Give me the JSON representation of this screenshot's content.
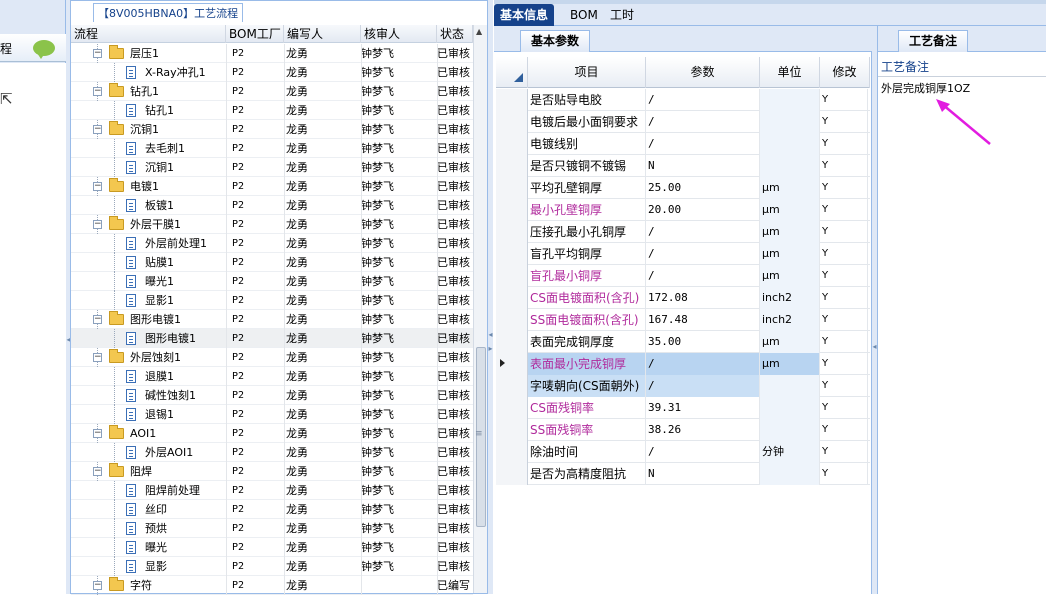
{
  "left_panel": {
    "caption": "程"
  },
  "tree": {
    "title": "【8V005HBNA0】工艺流程",
    "columns": [
      "流程",
      "BOM工厂",
      "编写人",
      "核审人",
      "状态"
    ],
    "rows": [
      {
        "name": "层压1",
        "level": 1,
        "bom": "P2",
        "writer": "龙勇",
        "reviewer": "钟梦飞",
        "status": "已审核"
      },
      {
        "name": "X-Ray冲孔1",
        "level": 2,
        "bom": "P2",
        "writer": "龙勇",
        "reviewer": "钟梦飞",
        "status": "已审核"
      },
      {
        "name": "钻孔1",
        "level": 1,
        "bom": "P2",
        "writer": "龙勇",
        "reviewer": "钟梦飞",
        "status": "已审核"
      },
      {
        "name": "钻孔1",
        "level": 2,
        "bom": "P2",
        "writer": "龙勇",
        "reviewer": "钟梦飞",
        "status": "已审核"
      },
      {
        "name": "沉铜1",
        "level": 1,
        "bom": "P2",
        "writer": "龙勇",
        "reviewer": "钟梦飞",
        "status": "已审核"
      },
      {
        "name": "去毛刺1",
        "level": 2,
        "bom": "P2",
        "writer": "龙勇",
        "reviewer": "钟梦飞",
        "status": "已审核"
      },
      {
        "name": "沉铜1",
        "level": 2,
        "bom": "P2",
        "writer": "龙勇",
        "reviewer": "钟梦飞",
        "status": "已审核"
      },
      {
        "name": "电镀1",
        "level": 1,
        "bom": "P2",
        "writer": "龙勇",
        "reviewer": "钟梦飞",
        "status": "已审核"
      },
      {
        "name": "板镀1",
        "level": 2,
        "bom": "P2",
        "writer": "龙勇",
        "reviewer": "钟梦飞",
        "status": "已审核"
      },
      {
        "name": "外层干膜1",
        "level": 1,
        "bom": "P2",
        "writer": "龙勇",
        "reviewer": "钟梦飞",
        "status": "已审核"
      },
      {
        "name": "外层前处理1",
        "level": 2,
        "bom": "P2",
        "writer": "龙勇",
        "reviewer": "钟梦飞",
        "status": "已审核"
      },
      {
        "name": "贴膜1",
        "level": 2,
        "bom": "P2",
        "writer": "龙勇",
        "reviewer": "钟梦飞",
        "status": "已审核"
      },
      {
        "name": "曝光1",
        "level": 2,
        "bom": "P2",
        "writer": "龙勇",
        "reviewer": "钟梦飞",
        "status": "已审核"
      },
      {
        "name": "显影1",
        "level": 2,
        "bom": "P2",
        "writer": "龙勇",
        "reviewer": "钟梦飞",
        "status": "已审核"
      },
      {
        "name": "图形电镀1",
        "level": 1,
        "bom": "P2",
        "writer": "龙勇",
        "reviewer": "钟梦飞",
        "status": "已审核"
      },
      {
        "name": "图形电镀1",
        "level": 2,
        "bom": "P2",
        "writer": "龙勇",
        "reviewer": "钟梦飞",
        "status": "已审核",
        "selected": true
      },
      {
        "name": "外层蚀刻1",
        "level": 1,
        "bom": "P2",
        "writer": "龙勇",
        "reviewer": "钟梦飞",
        "status": "已审核"
      },
      {
        "name": "退膜1",
        "level": 2,
        "bom": "P2",
        "writer": "龙勇",
        "reviewer": "钟梦飞",
        "status": "已审核"
      },
      {
        "name": "碱性蚀刻1",
        "level": 2,
        "bom": "P2",
        "writer": "龙勇",
        "reviewer": "钟梦飞",
        "status": "已审核"
      },
      {
        "name": "退锡1",
        "level": 2,
        "bom": "P2",
        "writer": "龙勇",
        "reviewer": "钟梦飞",
        "status": "已审核"
      },
      {
        "name": "AOI1",
        "level": 1,
        "bom": "P2",
        "writer": "龙勇",
        "reviewer": "钟梦飞",
        "status": "已审核"
      },
      {
        "name": "外层AOI1",
        "level": 2,
        "bom": "P2",
        "writer": "龙勇",
        "reviewer": "钟梦飞",
        "status": "已审核"
      },
      {
        "name": "阻焊",
        "level": 1,
        "bom": "P2",
        "writer": "龙勇",
        "reviewer": "钟梦飞",
        "status": "已审核"
      },
      {
        "name": "阻焊前处理",
        "level": 2,
        "bom": "P2",
        "writer": "龙勇",
        "reviewer": "钟梦飞",
        "status": "已审核"
      },
      {
        "name": "丝印",
        "level": 2,
        "bom": "P2",
        "writer": "龙勇",
        "reviewer": "钟梦飞",
        "status": "已审核"
      },
      {
        "name": "预烘",
        "level": 2,
        "bom": "P2",
        "writer": "龙勇",
        "reviewer": "钟梦飞",
        "status": "已审核"
      },
      {
        "name": "曝光",
        "level": 2,
        "bom": "P2",
        "writer": "龙勇",
        "reviewer": "钟梦飞",
        "status": "已审核"
      },
      {
        "name": "显影",
        "level": 2,
        "bom": "P2",
        "writer": "龙勇",
        "reviewer": "钟梦飞",
        "status": "已审核"
      },
      {
        "name": "字符",
        "level": 1,
        "bom": "P2",
        "writer": "龙勇",
        "reviewer": "",
        "status": "已编写"
      }
    ]
  },
  "tabs": [
    "基本信息",
    "BOM",
    "工时"
  ],
  "params": {
    "subtab": "基本参数",
    "columns": [
      "项目",
      "参数",
      "单位",
      "修改"
    ],
    "rows": [
      {
        "item": "是否贴导电胶",
        "param": "/",
        "unit": "",
        "mod": "Y"
      },
      {
        "item": "电镀后最小面铜要求",
        "param": "/",
        "unit": "",
        "mod": "Y"
      },
      {
        "item": "电镀线别",
        "param": "/",
        "unit": "",
        "mod": "Y"
      },
      {
        "item": "是否只镀铜不镀锡",
        "param": "N",
        "unit": "",
        "mod": "Y"
      },
      {
        "item": "平均孔壁铜厚",
        "param": "25.00",
        "unit": "μm",
        "mod": "Y"
      },
      {
        "item": "最小孔壁铜厚",
        "param": "20.00",
        "unit": "μm",
        "mod": "Y",
        "color": "magenta"
      },
      {
        "item": "压接孔最小孔铜厚",
        "param": "/",
        "unit": "μm",
        "mod": "Y"
      },
      {
        "item": "盲孔平均铜厚",
        "param": "/",
        "unit": "μm",
        "mod": "Y"
      },
      {
        "item": "盲孔最小铜厚",
        "param": "/",
        "unit": "μm",
        "mod": "Y",
        "color": "magenta"
      },
      {
        "item": "CS面电镀面积(含孔)",
        "param": "172.08",
        "unit": "inch2",
        "mod": "Y",
        "color": "magenta"
      },
      {
        "item": "SS面电镀面积(含孔)",
        "param": "167.48",
        "unit": "inch2",
        "mod": "Y",
        "color": "magenta"
      },
      {
        "item": "表面完成铜厚度",
        "param": "35.00",
        "unit": "μm",
        "mod": "Y"
      },
      {
        "item": "表面最小完成铜厚",
        "param": "/",
        "unit": "μm",
        "mod": "Y",
        "color": "magenta",
        "highlight": "hl",
        "current": true
      },
      {
        "item": "字唛朝向(CS面朝外)",
        "param": "/",
        "unit": "",
        "mod": "Y",
        "highlight": "hl2"
      },
      {
        "item": "CS面残铜率",
        "param": "39.31",
        "unit": "",
        "mod": "Y",
        "color": "magenta"
      },
      {
        "item": "SS面残铜率",
        "param": "38.26",
        "unit": "",
        "mod": "Y",
        "color": "magenta"
      },
      {
        "item": "除油时间",
        "param": "/",
        "unit": "分钟",
        "mod": "Y"
      },
      {
        "item": "是否为高精度阻抗",
        "param": "N",
        "unit": "",
        "mod": "Y"
      }
    ]
  },
  "notes": {
    "subtab": "工艺备注",
    "header": "工艺备注",
    "text": "外层完成铜厚1OZ"
  },
  "colors": {
    "accent": "#15428b",
    "panel_bg": "#dfe8f6",
    "magenta_text": "#b02a9c",
    "annotation_arrow": "#e21ce0"
  }
}
